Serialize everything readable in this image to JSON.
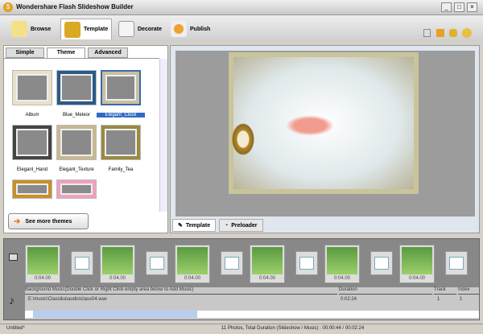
{
  "window": {
    "title": "Wondershare Flash Slideshow Builder"
  },
  "toolbar": {
    "browse": "Browse",
    "template": "Template",
    "decorate": "Decorate",
    "publish": "Publish"
  },
  "subtabs": [
    "Simple",
    "Theme",
    "Advanced"
  ],
  "themes": [
    {
      "label": "Album"
    },
    {
      "label": "Blue_Meteor"
    },
    {
      "label": "Elegant_Clock",
      "selected": true
    },
    {
      "label": "Elegant_Hand"
    },
    {
      "label": "Elegant_Texture"
    },
    {
      "label": "Family_Tea"
    }
  ],
  "more_themes": "See more themes",
  "preview_tabs": {
    "template": "Template",
    "preloader": "Preloader"
  },
  "clips": [
    "0:04.00",
    "0:04.00",
    "0:04.00",
    "0:04.00",
    "0:04.00",
    "0:04.00"
  ],
  "music": {
    "header": "Background Music(Double Click or Right Click empty area below to Add Music)",
    "duration_h": "Duration",
    "track_h": "Track",
    "index_h": "Index",
    "file": "E:\\music\\Classika\\audio\\class04.wav",
    "duration": "0:02:24",
    "track": "1",
    "index": "1"
  },
  "scroll": {
    "position": 0.6
  },
  "status": {
    "left": "Untitled*",
    "summary": "11 Photos, Total Duration (Slideshow / Music) : 00:00:44 / 00:02:24"
  }
}
